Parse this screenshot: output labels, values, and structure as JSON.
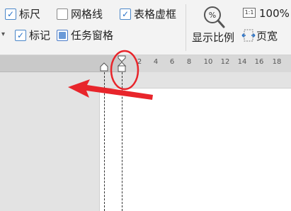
{
  "ribbon": {
    "checkboxes": [
      {
        "label": "标尺",
        "checked": true
      },
      {
        "label": "网格线",
        "checked": false
      },
      {
        "label": "表格虚框",
        "checked": true
      },
      {
        "label": "标记",
        "checked": true
      },
      {
        "label": "任务窗格",
        "checked": "partial"
      }
    ],
    "zoom_ratio_label": "显示比例",
    "zoom_100_icon_text": "1:1",
    "zoom_100_label": "100%",
    "page_width_label": "页宽"
  },
  "ruler": {
    "ticks": [
      "2",
      "4",
      "6",
      "8",
      "10",
      "12",
      "14",
      "16",
      "18"
    ]
  },
  "annotation": {
    "color": "#e8252b"
  }
}
